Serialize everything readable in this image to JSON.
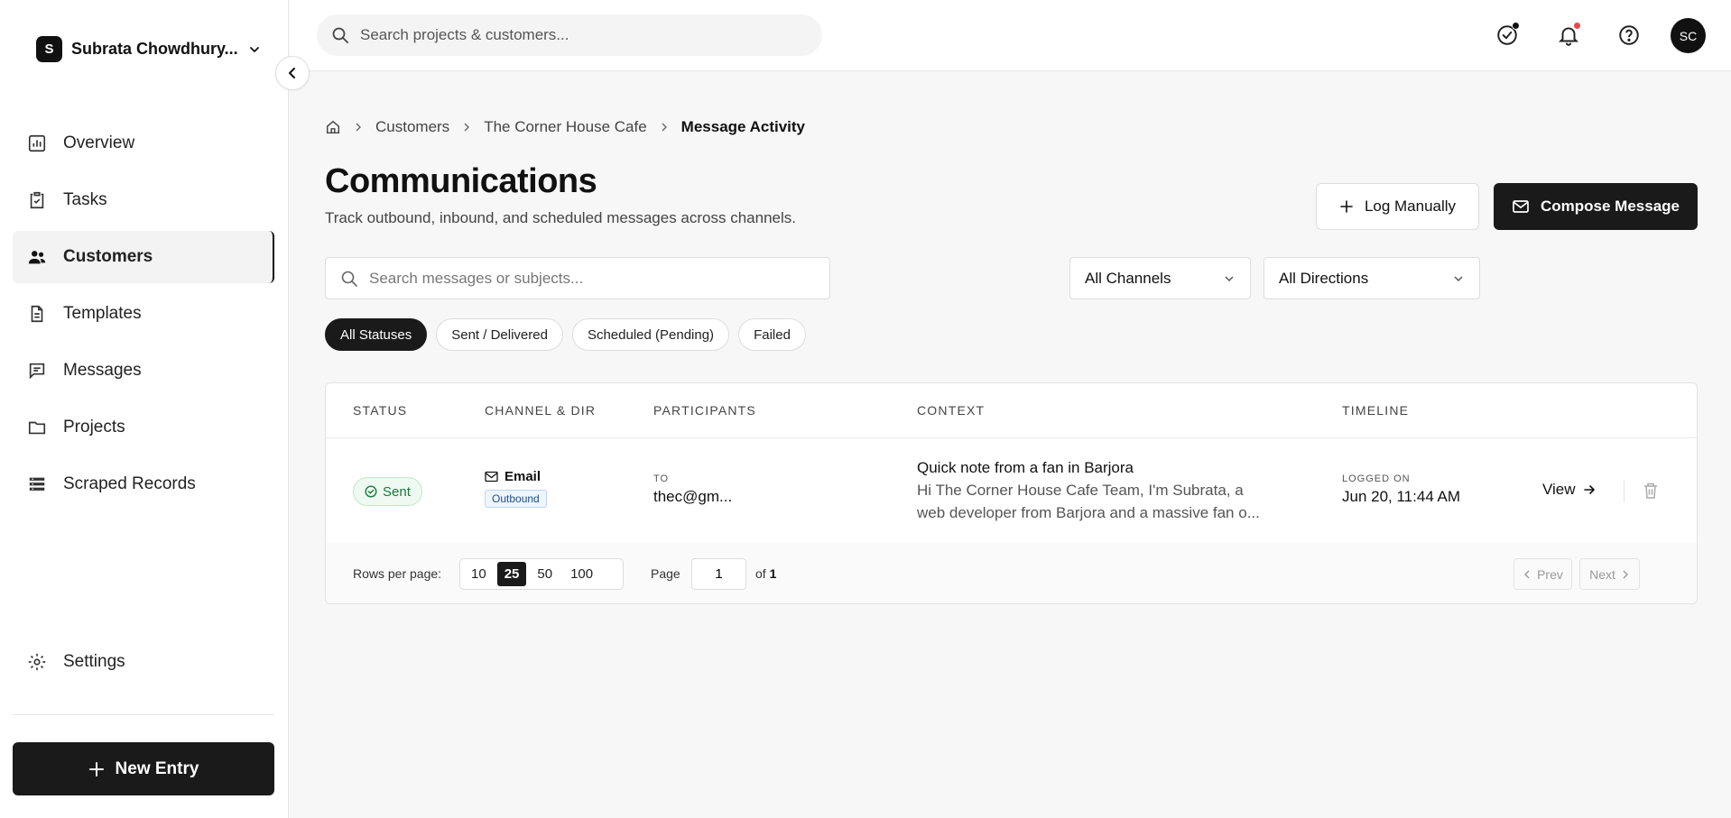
{
  "sidebar": {
    "workspace_initial": "S",
    "workspace_name": "Subrata Chowdhury...",
    "items": [
      {
        "label": "Overview",
        "icon": "chart-icon"
      },
      {
        "label": "Tasks",
        "icon": "clipboard-check-icon"
      },
      {
        "label": "Customers",
        "icon": "users-icon",
        "active": true
      },
      {
        "label": "Templates",
        "icon": "document-icon"
      },
      {
        "label": "Messages",
        "icon": "chat-icon"
      },
      {
        "label": "Projects",
        "icon": "folder-icon"
      },
      {
        "label": "Scraped Records",
        "icon": "list-icon"
      }
    ],
    "settings_label": "Settings",
    "new_entry_label": "New Entry"
  },
  "topbar": {
    "search_placeholder": "Search projects & customers...",
    "avatar_initials": "SC",
    "icons": [
      "task-check-icon",
      "bell-icon",
      "help-icon"
    ]
  },
  "breadcrumb": {
    "items": [
      "Customers",
      "The Corner House Cafe"
    ],
    "current": "Message Activity"
  },
  "page": {
    "title": "Communications",
    "subtitle": "Track outbound, inbound, and scheduled messages across channels.",
    "log_button": "Log Manually",
    "compose_button": "Compose Message"
  },
  "filters": {
    "search_placeholder": "Search messages or subjects...",
    "channel_select": "All Channels",
    "direction_select": "All Directions",
    "status_chips": [
      "All Statuses",
      "Sent / Delivered",
      "Scheduled (Pending)",
      "Failed"
    ],
    "active_chip": 0
  },
  "table": {
    "columns": [
      "STATUS",
      "CHANNEL & DIR",
      "PARTICIPANTS",
      "CONTEXT",
      "TIMELINE"
    ],
    "rows": [
      {
        "status": "Sent",
        "channel": "Email",
        "direction": "Outbound",
        "participant_label": "TO",
        "participant": "thec@gm...",
        "subject": "Quick note from a fan in Barjora",
        "preview_line1": "Hi The Corner House Cafe Team, I'm Subrata, a",
        "preview_line2": "web developer from Barjora and a massive fan o...",
        "timeline_label": "LOGGED ON",
        "timeline": "Jun 20, 11:44 AM",
        "view_label": "View"
      }
    ]
  },
  "pagination": {
    "rows_per_page_label": "Rows per page:",
    "options": [
      "10",
      "25",
      "50",
      "100"
    ],
    "selected": "25",
    "page_label": "Page",
    "current_page": "1",
    "of_label": "of",
    "total_pages": "1",
    "prev_label": "Prev",
    "next_label": "Next"
  },
  "colors": {
    "accent": "#1a1a1a",
    "sent_green": "#177a3a",
    "notification_red": "#e5484d"
  }
}
